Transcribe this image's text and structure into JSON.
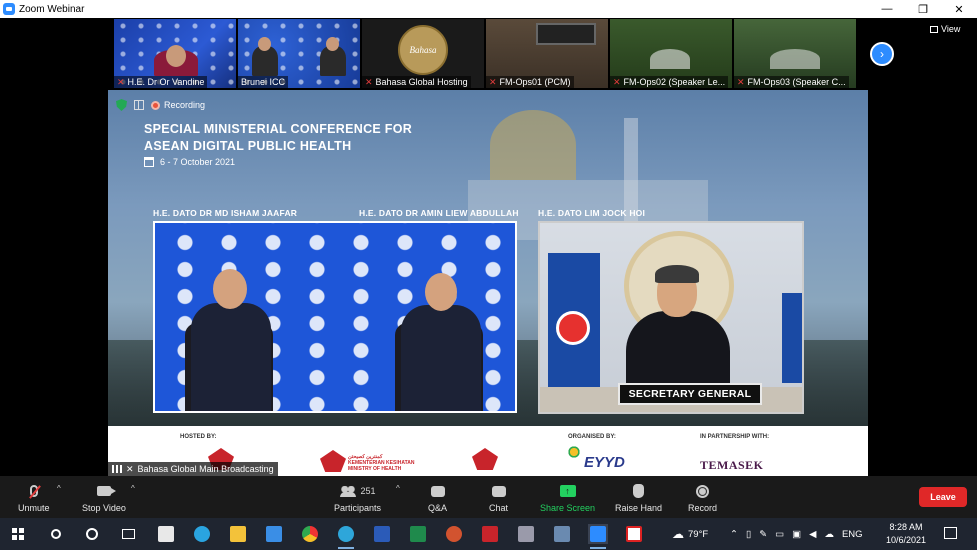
{
  "window": {
    "title": "Zoom Webinar",
    "minimize": "—",
    "restore": "❐",
    "close": "✕"
  },
  "thumbnails": [
    {
      "label": "H.E. Dr Or Vandine"
    },
    {
      "label": "Brunei ICC"
    },
    {
      "label": "Bahasa Global Hosting",
      "logo_text": "Bahasa"
    },
    {
      "label": "FM-Ops01 (PCM)"
    },
    {
      "label": "FM-Ops02 (Speaker Le..."
    },
    {
      "label": "FM-Ops03 (Speaker C..."
    }
  ],
  "view_button": "View",
  "next_arrow": "›",
  "recording_label": "Recording",
  "conference": {
    "title_line1": "SPECIAL MINISTERIAL CONFERENCE FOR",
    "title_line2": "ASEAN DIGITAL PUBLIC HEALTH",
    "date": "6 - 7 October 2021",
    "speaker1": "H.E. DATO DR MD ISHAM JAAFAR",
    "speaker2": "H.E. DATO DR AMIN LIEW ABDULLAH",
    "speaker3": "H.E. DATO LIM JOCK HOI",
    "nameplate": "SECRETARY GENERAL",
    "hosted_by": "HOSTED BY:",
    "organised_by": "ORGANISED BY:",
    "partnership": "IN PARTNERSHIP WITH:",
    "kkm_line1": "كمنترين كصيحتن",
    "kkm_line2": "KEMENTERIAN KESIHATAN",
    "kkm_line3": "MINISTRY OF HEALTH",
    "organiser_logo": "EYYD",
    "partner_logo": "TEMASEK",
    "host_name": "Bahasa Global Main Broadcasting"
  },
  "toolbar": {
    "unmute": "Unmute",
    "stop_video": "Stop Video",
    "participants": "Participants",
    "participants_count": "251",
    "qa": "Q&A",
    "chat": "Chat",
    "share_screen": "Share Screen",
    "raise_hand": "Raise Hand",
    "record": "Record",
    "leave": "Leave",
    "caret": "^"
  },
  "taskbar": {
    "weather": "79°F",
    "lang": "ENG",
    "time": "8:28 AM",
    "date": "10/6/2021"
  },
  "colors": {
    "zoom_blue": "#2d8cff",
    "leave_red": "#e02828",
    "share_green": "#23d160"
  }
}
